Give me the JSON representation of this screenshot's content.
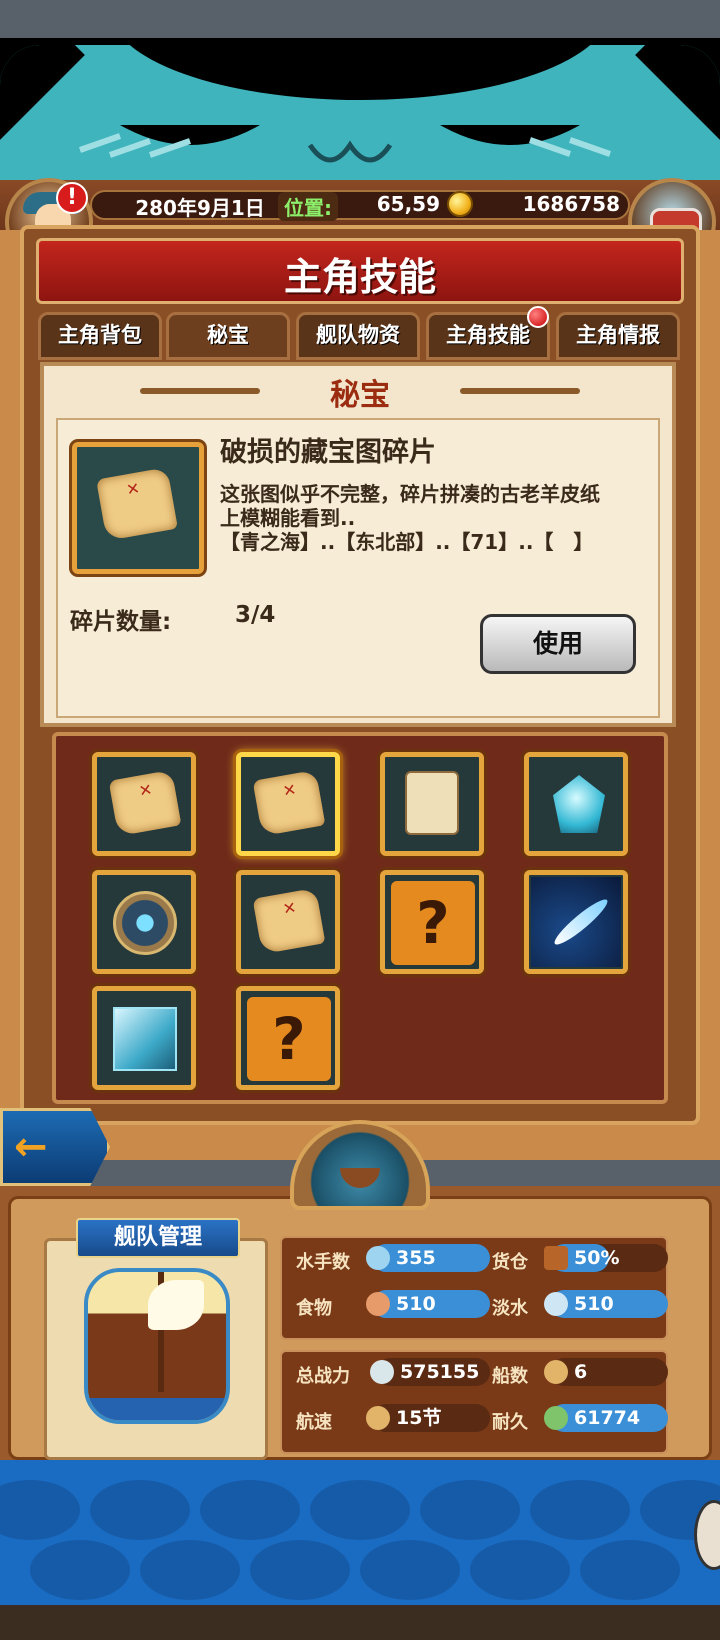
{
  "header": {
    "date": "280年9月1日",
    "position_label": "位置:",
    "position_value": "65,59",
    "gold": "1686758",
    "alert": "!"
  },
  "title": "主角技能",
  "tabs": [
    {
      "label": "主角背包",
      "active": false
    },
    {
      "label": "秘宝",
      "active": true
    },
    {
      "label": "舰队物资",
      "active": false
    },
    {
      "label": "主角技能",
      "active": false,
      "badge": true
    },
    {
      "label": "主角情报",
      "active": false
    }
  ],
  "detail": {
    "section_title": "秘宝",
    "item_name": "破损的藏宝图碎片",
    "desc_line1": "这张图似乎不完整，碎片拼凑的古老羊皮纸",
    "desc_line2": "上模糊能看到..",
    "desc_line3": "【青之海】..【东北部】..【71】..【　】",
    "count_label": "碎片数量:",
    "count_value": "3/4",
    "use_button": "使用"
  },
  "grid": [
    {
      "icon": "treasure-map-fragment-icon"
    },
    {
      "icon": "treasure-map-fragment-icon",
      "selected": true
    },
    {
      "icon": "scroll-with-bone-icon"
    },
    {
      "icon": "blue-crystal-icon"
    },
    {
      "icon": "compass-emblem-icon"
    },
    {
      "icon": "treasure-map-fragment-icon"
    },
    {
      "icon": "unknown-question-icon",
      "text": "?"
    },
    {
      "icon": "white-feather-icon"
    },
    {
      "icon": "ice-cube-icon"
    },
    {
      "icon": "unknown-question-icon",
      "text": "?"
    }
  ],
  "fleet": {
    "banner": "舰队管理",
    "sailors_label": "水手数",
    "sailors_value": "355",
    "cargo_label": "货仓",
    "cargo_value": "50%",
    "cargo_fraction": 0.5,
    "food_label": "食物",
    "food_value": "510",
    "water_label": "淡水",
    "water_value": "510",
    "power_label": "总战力",
    "power_value": "575155",
    "ships_label": "船数",
    "ships_value": "6",
    "speed_label": "航速",
    "speed_value": "15节",
    "durability_label": "耐久",
    "durability_value": "61774"
  },
  "colors": {
    "title_red": "#c3261d",
    "frame_gold": "#e5a53d",
    "stat_blue": "#3b8fd6",
    "sea_blue": "#1a6bc2"
  }
}
